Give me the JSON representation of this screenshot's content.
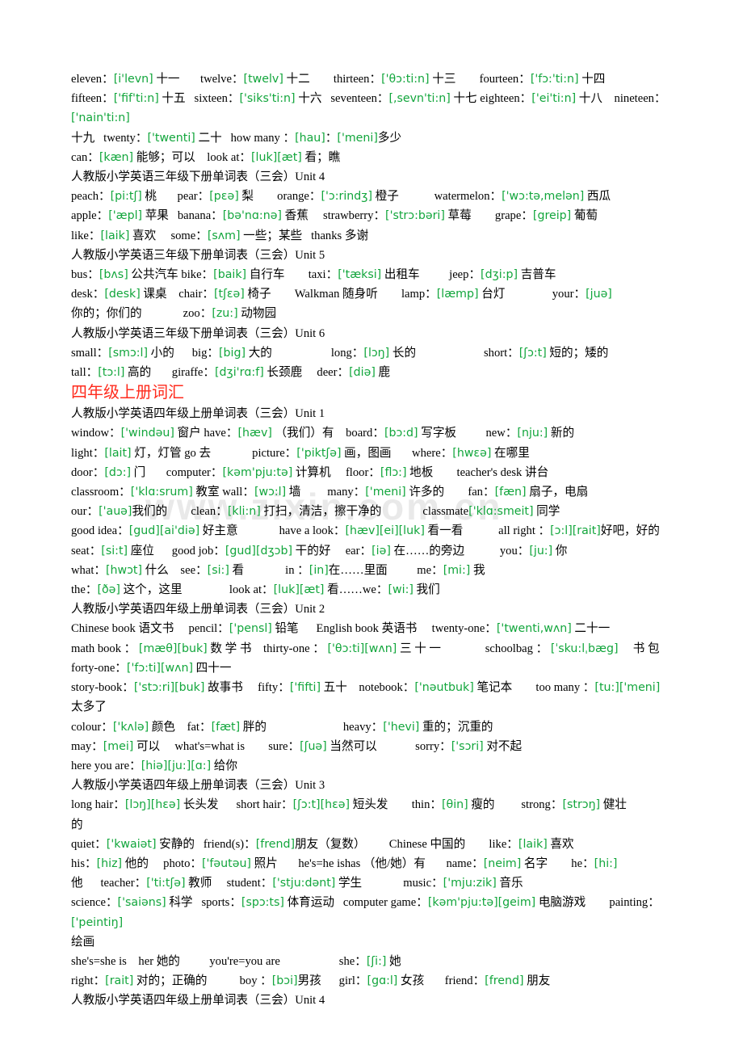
{
  "document": {
    "watermark": "www.zixin.com.cn",
    "colors": {
      "phonetic": "#12a63c",
      "heading_red": "#ff2a1c",
      "text": "#000000",
      "background": "#ffffff"
    }
  },
  "lines": [
    {
      "id": "l1",
      "type": "entry",
      "text": "eleven：[i'levn] 十一       twelve：[twelv] 十二        thirteen：['θɔ:ti:n] 十三        fourteen：['fɔ:'ti:n] 十四"
    },
    {
      "id": "l2",
      "type": "entry",
      "text": "fifteen：['fif'ti:n] 十五   sixteen：['siks'ti:n] 十六   seventeen：[,sevn'ti:n] 十七 eighteen：['ei'ti:n] 十八    nineteen：['nain'ti:n]"
    },
    {
      "id": "l3",
      "type": "entry",
      "text": "十九   twenty：['twenti] 二十   how many ：[hau]：['meni]多少"
    },
    {
      "id": "l4",
      "type": "entry",
      "text": "can：[kæn] 能够；可以    look at：[luk][æt] 看；瞧"
    },
    {
      "id": "l5",
      "type": "unit",
      "text": "人教版小学英语三年级下册单词表（三会）Unit 4"
    },
    {
      "id": "l6",
      "type": "entry",
      "text": "peach：[pi:tʃ] 桃       pear：[pɛə] 梨        orange：['ɔ:rindʒ] 橙子            watermelon：['wɔ:tə,melən] 西瓜"
    },
    {
      "id": "l7",
      "type": "entry",
      "text": "apple：['æpl] 苹果   banana：[bə'nɑ:nə] 香蕉     strawberry：['strɔ:bəri] 草莓        grape：[greip] 葡萄"
    },
    {
      "id": "l8",
      "type": "entry",
      "text": "like：[laik] 喜欢     some：[sʌm] 一些；某些   thanks 多谢"
    },
    {
      "id": "l9",
      "type": "unit",
      "text": "人教版小学英语三年级下册单词表（三会）Unit 5"
    },
    {
      "id": "l10",
      "type": "entry",
      "text": "bus：[bʌs] 公共汽车 bike：[baik] 自行车        taxi：['tæksi] 出租车          jeep：[dʒi:p] 吉普车"
    },
    {
      "id": "l11",
      "type": "entry",
      "text": "desk：[desk] 课桌    chair：[tʃɛə] 椅子        Walkman 随身听        lamp：[læmp] 台灯                your：[juə]"
    },
    {
      "id": "l12",
      "type": "entry",
      "text": "你的；你们的              zoo：[zu:] 动物园"
    },
    {
      "id": "l13",
      "type": "unit",
      "text": "人教版小学英语三年级下册单词表（三会）Unit 6"
    },
    {
      "id": "l14",
      "type": "entry",
      "text": "small：[smɔ:l] 小的      big：[big] 大的                    long：[lɔŋ] 长的                       short：[ʃɔ:t] 短的；矮的"
    },
    {
      "id": "l15",
      "type": "entry",
      "text": "tall：[tɔ:l] 高的       giraffe：[dʒi'rɑ:f] 长颈鹿     deer：[diə] 鹿"
    },
    {
      "id": "l16",
      "type": "heading",
      "text": "四年级上册词汇"
    },
    {
      "id": "l17",
      "type": "unit",
      "text": "人教版小学英语四年级上册单词表（三会）Unit 1"
    },
    {
      "id": "l18",
      "type": "entry",
      "text": "window：['windəu] 窗户 have：[hæv] （我们）有    board：[bɔ:d] 写字板          new：[nju:] 新的"
    },
    {
      "id": "l19",
      "type": "entry",
      "text": "light：[lait] 灯，灯管 go 去              picture：['piktʃə] 画，图画       where：[hwɛə] 在哪里"
    },
    {
      "id": "l20",
      "type": "entry",
      "text": "door：[dɔ:] 门       computer：[kəm'pju:tə] 计算机     floor：[flɔ:] 地板        teacher's desk 讲台"
    },
    {
      "id": "l21",
      "type": "entry",
      "text": "classroom：['klɑ:srum] 教室 wall：[wɔ:l] 墙         many：['meni] 许多的        fan：[fæn] 扇子，电扇"
    },
    {
      "id": "l22",
      "type": "entry",
      "text": "our：['auə]我们的        clean：[kli:n] 打扫，清洁，擦干净的              classmate['klɑ:smeit] 同学"
    },
    {
      "id": "l23",
      "type": "entry",
      "text": "good idea：[gud][ai'diə] 好主意              have a look：[hæv][ei][luk] 看一看            all right ：[ɔ:l][rait]好吧，好的"
    },
    {
      "id": "l24",
      "type": "entry",
      "text": "seat：[si:t] 座位      good job：[gud][dʒɔb] 干的好     ear：[iə] 在……的旁边            you：[ju:] 你"
    },
    {
      "id": "l25",
      "type": "entry",
      "text": "what：[hwɔt] 什么    see：[si:] 看              in ：[in]在……里面          me：[mi:] 我"
    },
    {
      "id": "l26",
      "type": "entry",
      "text": "the：[ðə] 这个，这里                look at：[luk][æt] 看……we：[wi:] 我们"
    },
    {
      "id": "l27",
      "type": "unit",
      "text": "人教版小学英语四年级上册单词表（三会）Unit 2"
    },
    {
      "id": "l28",
      "type": "entry",
      "text": "Chinese book 语文书     pencil：['pensl] 铅笔      English book 英语书     twenty-one：['twenti,wʌn] 二十一"
    },
    {
      "id": "l29",
      "type": "entry",
      "text": "math book ： [mæθ][buk] 数 学 书    thirty-one ： ['θɔ:ti][wʌn] 三 十 一               schoolbag ： [ˈsku:lˌbæg]     书 包"
    },
    {
      "id": "l30",
      "type": "entry",
      "text": "forty-one：['fɔ:ti][wʌn] 四十一"
    },
    {
      "id": "l31",
      "type": "entry",
      "text": "story-book：['stɔ:ri][buk] 故事书     fifty：['fifti] 五十    notebook：['nəutbuk] 笔记本        too many ：[tu:]['meni]"
    },
    {
      "id": "l32",
      "type": "entry",
      "text": "太多了"
    },
    {
      "id": "l33",
      "type": "entry",
      "text": "colour：['kʌlə] 颜色    fat：[fæt] 胖的                          heavy：['hevi] 重的；沉重的"
    },
    {
      "id": "l34",
      "type": "entry",
      "text": "may：[mei] 可以     what's=what is        sure：[ʃuə] 当然可以             sorry：['sɔri] 对不起"
    },
    {
      "id": "l35",
      "type": "entry",
      "text": "here you are：[hiə][ju:][ɑ:] 给你"
    },
    {
      "id": "l36",
      "type": "unit",
      "text": "人教版小学英语四年级上册单词表（三会）Unit 3"
    },
    {
      "id": "l37",
      "type": "entry",
      "text": "long hair：[lɔŋ][hɛə] 长头发      short hair：[ʃɔ:t][hɛə] 短头发        thin：[θin] 瘦的         strong：[strɔŋ] 健壮"
    },
    {
      "id": "l38",
      "type": "entry",
      "text": "的"
    },
    {
      "id": "l39",
      "type": "entry",
      "text": "quiet：['kwaiət] 安静的   friend(s)：[frend]朋友（复数）        Chinese 中国的        like：[laik] 喜欢"
    },
    {
      "id": "l40",
      "type": "entry",
      "text": "his：[hiz] 他的     photo：['fəutəu] 照片       he's=he ishas （他/她）有       name：[neim] 名字        he：[hi:]"
    },
    {
      "id": "l41",
      "type": "entry",
      "text": "他      teacher：['ti:tʃə] 教师     student：['stju:dənt] 学生              music：['mju:zik] 音乐"
    },
    {
      "id": "l42",
      "type": "entry",
      "text": "science：['saiəns] 科学   sports：[spɔ:ts] 体育运动   computer game：[kəm'pju:tə][geim] 电脑游戏        painting：['peintiŋ]"
    },
    {
      "id": "l43",
      "type": "entry",
      "text": "绘画"
    },
    {
      "id": "l44",
      "type": "entry",
      "text": "she's=she is    her 她的          you're=you are                    she：[ʃi:] 她"
    },
    {
      "id": "l45",
      "type": "entry",
      "text": "right：[rait] 对的；正确的           boy ：[bɔi]男孩      girl：[gɑ:l] 女孩       friend：[frend] 朋友"
    },
    {
      "id": "l46",
      "type": "unit",
      "text": "人教版小学英语四年级上册单词表（三会）Unit 4"
    }
  ]
}
